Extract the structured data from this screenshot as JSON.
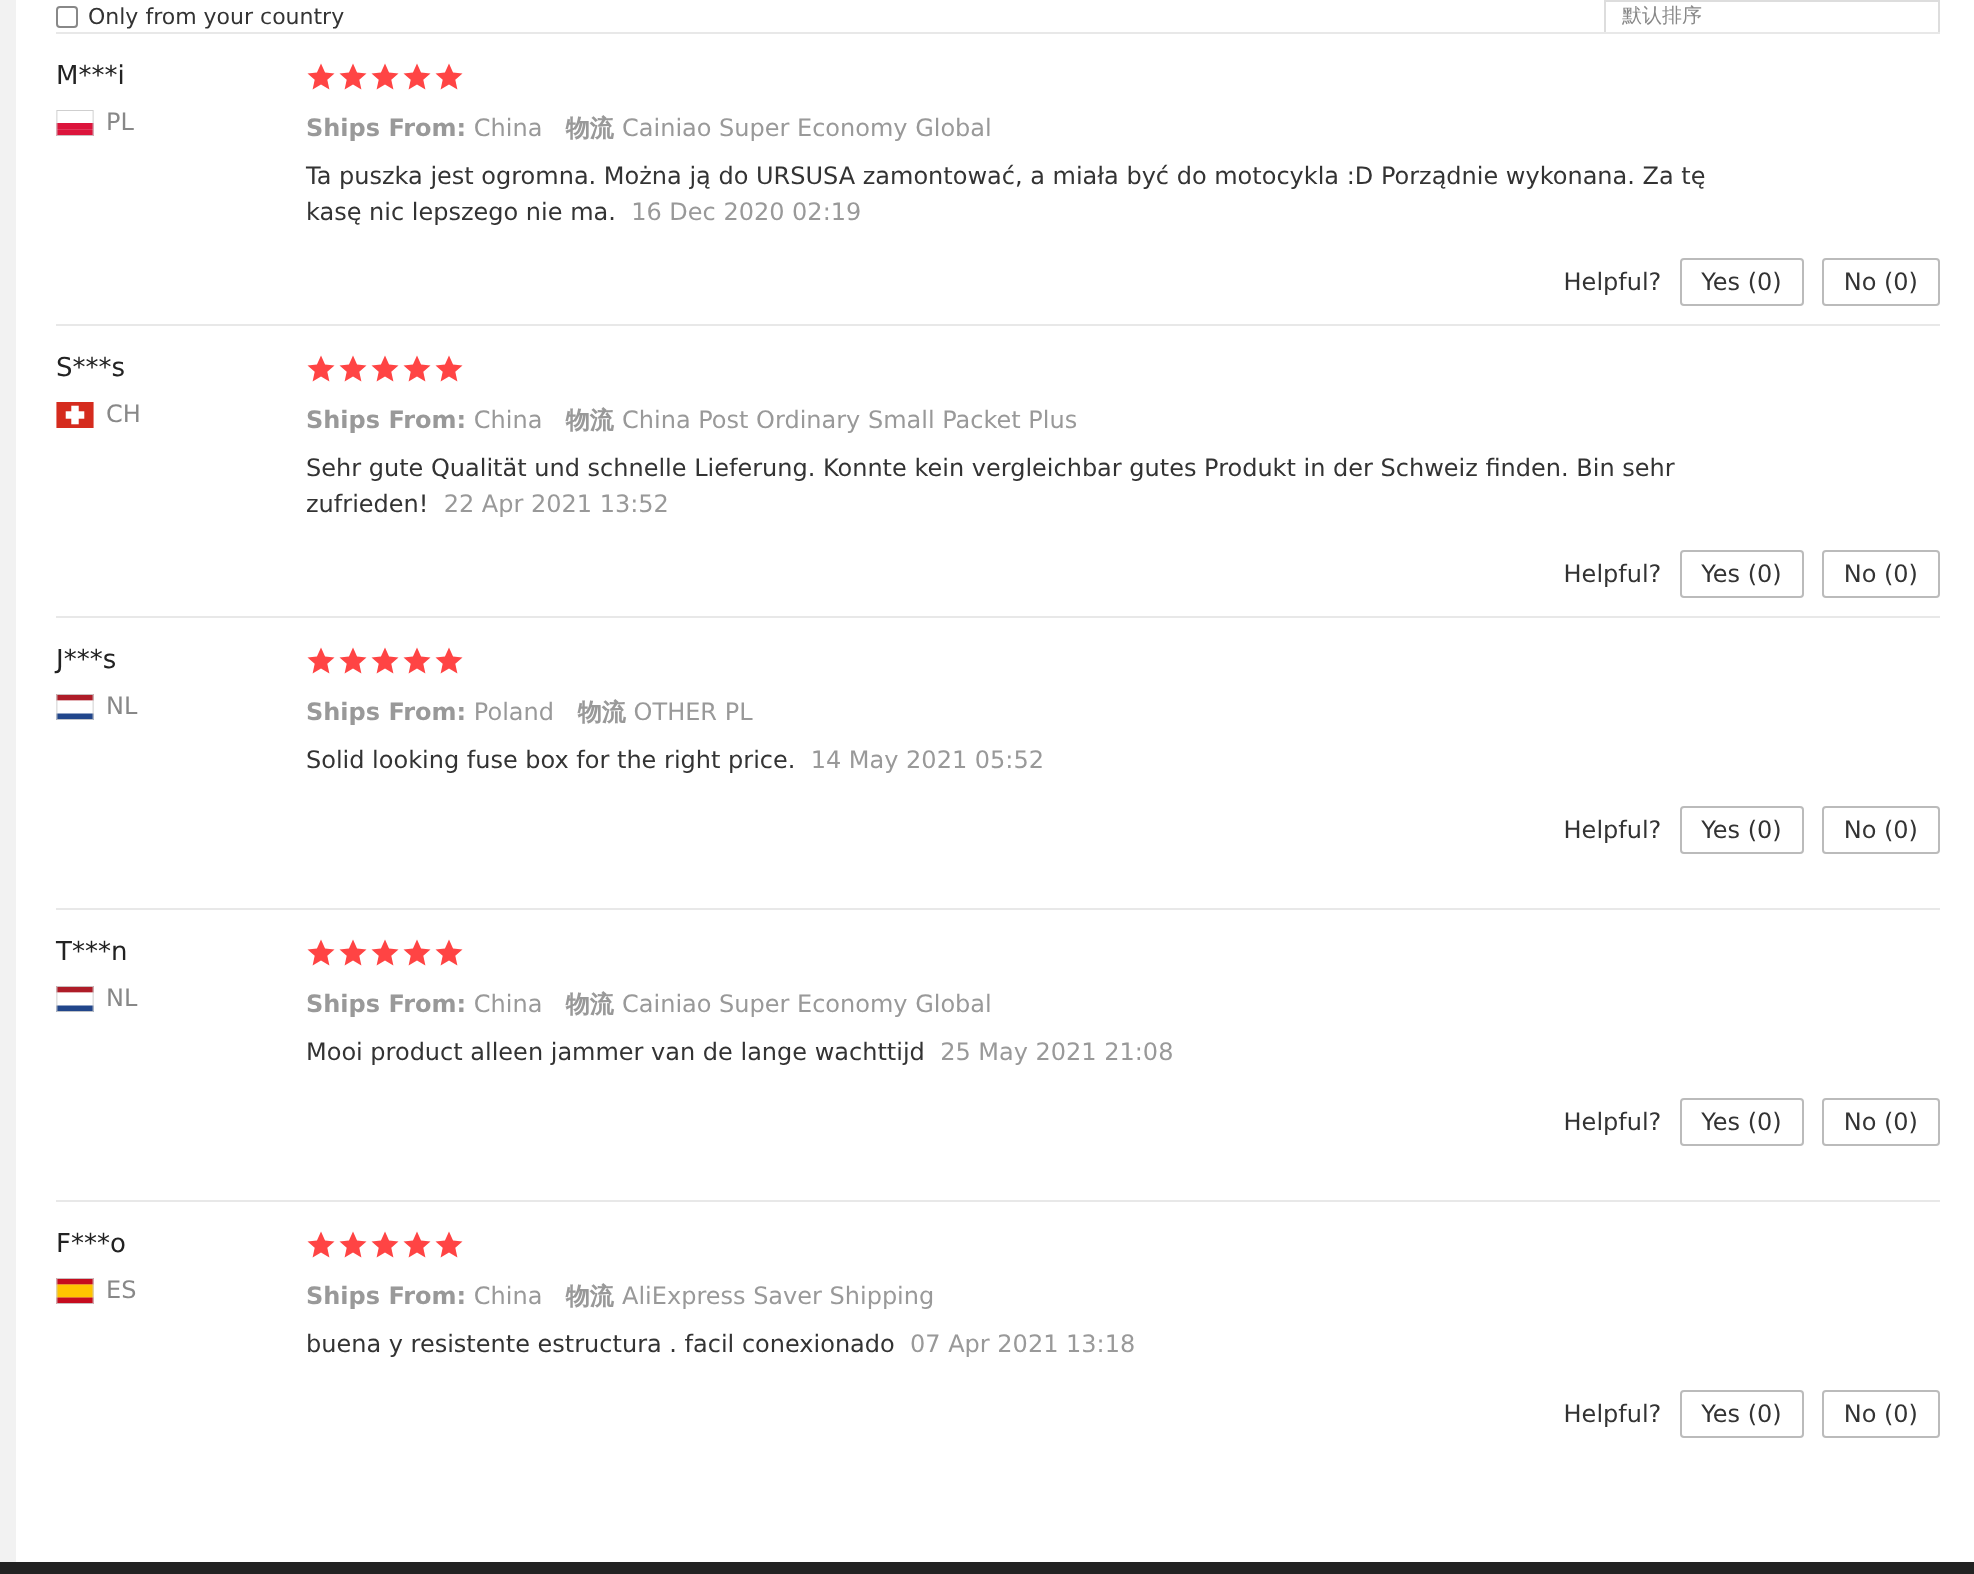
{
  "filter": {
    "checkbox_label": "Only from your country",
    "checked": false,
    "sort": "默认排序"
  },
  "reviews": [
    {
      "name": "M***i",
      "flag": {
        "kind": "pl"
      },
      "country": "PL",
      "stars": 5,
      "ships_label": "Ships From:",
      "ships_from": "China",
      "logistics_label": "物流",
      "logistics": "Cainiao Super Economy Global",
      "text": "Ta puszka jest ogromna. Można ją do URSUSA zamontować, a miała być do motocykla :D Porządnie wykonana. Za tę kasę nic lepszego nie ma.",
      "date": "16 Dec 2020 02:19",
      "helpful": "Helpful?",
      "yes": "Yes (0)",
      "no": "No (0)"
    },
    {
      "name": "S***s",
      "flag": {
        "kind": "ch"
      },
      "country": "CH",
      "stars": 5,
      "ships_label": "Ships From:",
      "ships_from": "China",
      "logistics_label": "物流",
      "logistics": "China Post Ordinary Small Packet Plus",
      "text": "Sehr gute Qualität und schnelle Lieferung. Konnte kein vergleichbar gutes Produkt in der Schweiz finden. Bin sehr zufrieden!",
      "date": "22 Apr 2021 13:52",
      "helpful": "Helpful?",
      "yes": "Yes (0)",
      "no": "No (0)"
    },
    {
      "name": "J***s",
      "flag": {
        "kind": "nl"
      },
      "country": "NL",
      "stars": 5,
      "ships_label": "Ships From:",
      "ships_from": "Poland",
      "logistics_label": "物流",
      "logistics": "OTHER PL",
      "text": "Solid looking fuse box for the right price.",
      "date": "14 May 2021 05:52",
      "helpful": "Helpful?",
      "yes": "Yes (0)",
      "no": "No (0)"
    },
    {
      "name": "T***n",
      "flag": {
        "kind": "nl"
      },
      "country": "NL",
      "stars": 5,
      "ships_label": "Ships From:",
      "ships_from": "China",
      "logistics_label": "物流",
      "logistics": "Cainiao Super Economy Global",
      "text": "Mooi product alleen jammer van de lange wachttijd",
      "date": "25 May 2021 21:08",
      "helpful": "Helpful?",
      "yes": "Yes (0)",
      "no": "No (0)"
    },
    {
      "name": "F***o",
      "flag": {
        "kind": "es"
      },
      "country": "ES",
      "stars": 5,
      "ships_label": "Ships From:",
      "ships_from": "China",
      "logistics_label": "物流",
      "logistics": "AliExpress Saver Shipping",
      "text": "buena y resistente estructura . facil conexionado",
      "date": "07 Apr 2021 13:18",
      "helpful": "Helpful?",
      "yes": "Yes (0)",
      "no": "No (0)"
    }
  ]
}
